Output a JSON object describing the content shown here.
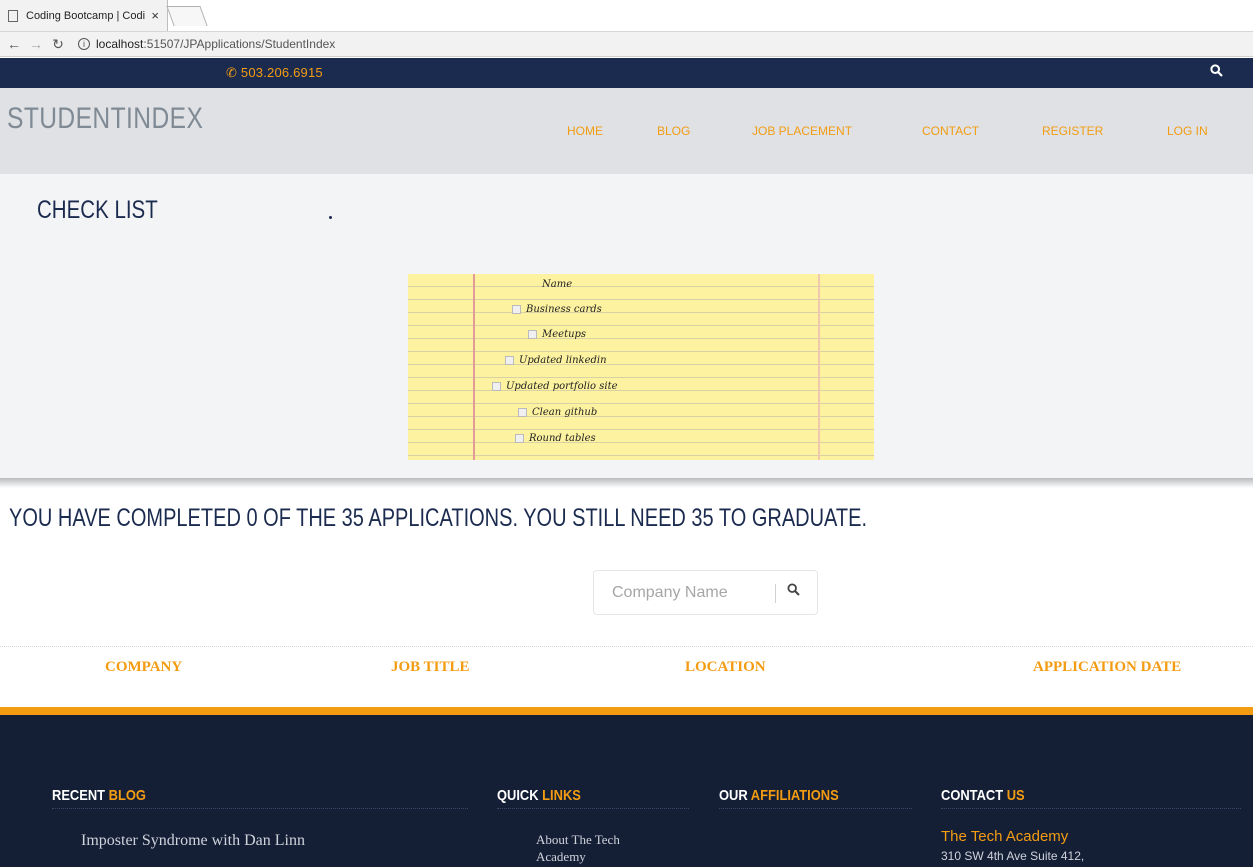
{
  "browser": {
    "tab_title": "Coding Bootcamp | Codi",
    "tab_close": "×",
    "url_host": "localhost",
    "url_path": ":51507/JPApplications/StudentIndex"
  },
  "topbar": {
    "phone_icon": "phone-icon",
    "phone": "503.206.6915",
    "search_icon": "search-icon"
  },
  "header": {
    "logo": "STUDENTINDEX",
    "nav": [
      "HOME",
      "BLOG",
      "JOB PLACEMENT",
      "CONTACT",
      "REGISTER",
      "LOG IN"
    ]
  },
  "checklist": {
    "title": "CHECK LIST",
    "heading": "Name",
    "items": [
      "Business cards",
      "Meetups",
      "Updated linkedin",
      "Updated portfolio site",
      "Clean github",
      "Round tables"
    ]
  },
  "summary": {
    "text": "YOU HAVE COMPLETED 0 OF THE 35 APPLICATIONS. YOU STILL NEED 35 TO GRADUATE."
  },
  "search": {
    "placeholder": "Company Name",
    "icon": "search-icon"
  },
  "table": {
    "columns": [
      "COMPANY",
      "JOB TITLE",
      "LOCATION",
      "APPLICATION DATE"
    ]
  },
  "footer": {
    "recent_blog": {
      "prefix": "RECENT",
      "accent": "BLOG",
      "item": "Imposter Syndrome with Dan Linn"
    },
    "quick_links": {
      "prefix": "QUICK",
      "accent": "LINKS",
      "item_line1": "About The Tech",
      "item_line2": "Academy"
    },
    "affiliations": {
      "prefix": "OUR",
      "accent": "AFFILIATIONS"
    },
    "contact": {
      "prefix": "CONTACT",
      "accent": "US",
      "org": "The Tech Academy",
      "address": "310 SW 4th Ave Suite 412,"
    }
  },
  "colors": {
    "navy": "#1b2b4f",
    "orange": "#f39c12",
    "footer_bg": "#141f36",
    "header_bg": "#dfe1e4",
    "notepad": "#fdf2a0"
  }
}
